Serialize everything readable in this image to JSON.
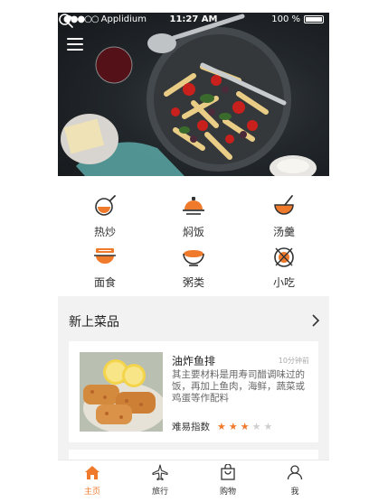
{
  "colors": {
    "accent": "#f07a2c",
    "star_off": "#cfcfcf"
  },
  "statusbar": {
    "carrier": "Applidium",
    "time": "11:27 AM",
    "battery": "100 %"
  },
  "icons": {
    "menu": "menu-icon",
    "search": "search-icon"
  },
  "categories": [
    {
      "label": "热炒",
      "icon": "wok-icon"
    },
    {
      "label": "焖饭",
      "icon": "rice-pot-icon"
    },
    {
      "label": "汤羹",
      "icon": "soup-icon"
    },
    {
      "label": "面食",
      "icon": "noodles-icon"
    },
    {
      "label": "粥类",
      "icon": "porridge-bowl-icon"
    },
    {
      "label": "小吃",
      "icon": "snack-icon"
    }
  ],
  "section": {
    "title": "新上菜品"
  },
  "recipe": {
    "title": "油炸鱼排",
    "time": "10分钟前",
    "description": "其主要材料是用寿司醋调味过的饭，再加上鱼肉，海鲜，蔬菜或鸡蛋等作配料",
    "difficulty_label": "难易指数",
    "rating": 3,
    "rating_max": 5
  },
  "tabbar": [
    {
      "label": "主页",
      "icon": "home-icon",
      "active": true
    },
    {
      "label": "旅行",
      "icon": "airplane-icon",
      "active": false
    },
    {
      "label": "购物",
      "icon": "shopping-bag-icon",
      "active": false
    },
    {
      "label": "我",
      "icon": "person-icon",
      "active": false
    }
  ]
}
